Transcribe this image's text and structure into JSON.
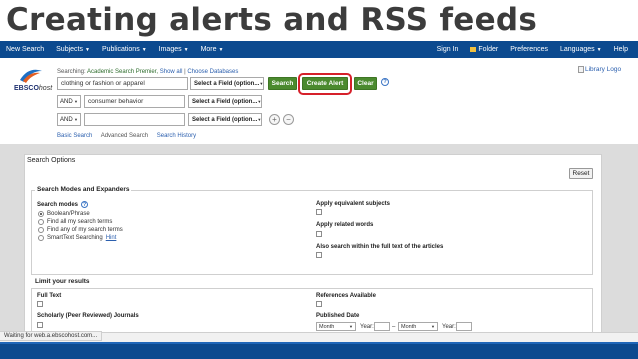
{
  "slide": {
    "title": "Creating alerts and RSS feeds"
  },
  "nav": {
    "left": [
      {
        "label": "New Search",
        "caret": false
      },
      {
        "label": "Subjects",
        "caret": true
      },
      {
        "label": "Publications",
        "caret": true
      },
      {
        "label": "Images",
        "caret": true
      },
      {
        "label": "More",
        "caret": true
      }
    ],
    "right": {
      "sign_in": "Sign In",
      "folder": "Folder",
      "preferences": "Preferences",
      "languages": "Languages",
      "help": "Help"
    }
  },
  "search": {
    "logo_brand": "EBSCO",
    "logo_suffix": "host",
    "searching_prefix": "Searching:",
    "database": "Academic Search Premier,",
    "show_all": "Show all",
    "separator": "|",
    "choose_databases": "Choose Databases",
    "rows": [
      {
        "bool": "",
        "value": "clothing or fashion or apparel",
        "field": "Select a Field (option..."
      },
      {
        "bool": "AND",
        "value": "consumer behavior",
        "field": "Select a Field (option..."
      },
      {
        "bool": "AND",
        "value": "",
        "field": "Select a Field (option..."
      }
    ],
    "search_button": "Search",
    "create_alert_button": "Create Alert",
    "clear_button": "Clear",
    "help_glyph": "?",
    "add_row_glyph": "+",
    "remove_row_glyph": "−",
    "links": {
      "basic_search": "Basic Search",
      "advanced_search": "Advanced Search",
      "search_history": "Search History"
    },
    "library_logo": "Library Logo"
  },
  "options": {
    "title": "Search Options",
    "reset": "Reset",
    "modes_section": "Search Modes and Expanders",
    "search_modes_label": "Search modes",
    "modes": [
      {
        "label": "Boolean/Phrase",
        "selected": true
      },
      {
        "label": "Find all my search terms",
        "selected": false
      },
      {
        "label": "Find any of my search terms",
        "selected": false
      },
      {
        "label": "SmartText Searching",
        "selected": false
      }
    ],
    "hint": "Hint",
    "apply_equivalent": "Apply equivalent subjects",
    "apply_related": "Apply related words",
    "full_text_search": "Also search within the full text of the articles",
    "limit_section": "Limit your results",
    "full_text": "Full Text",
    "scholarly": "Scholarly (Peer Reviewed) Journals",
    "references_available": "References Available",
    "published_date": "Published Date",
    "month_placeholder": "Month",
    "year_label": "Year:",
    "date_separator": "–"
  },
  "status": {
    "text": "Waiting for web.a.ebscohost.com..."
  },
  "colors": {
    "nav_blue": "#0c4a8f",
    "button_green": "#4b8a2e",
    "alert_highlight": "#d6202a",
    "link_blue": "#2b5fae"
  }
}
